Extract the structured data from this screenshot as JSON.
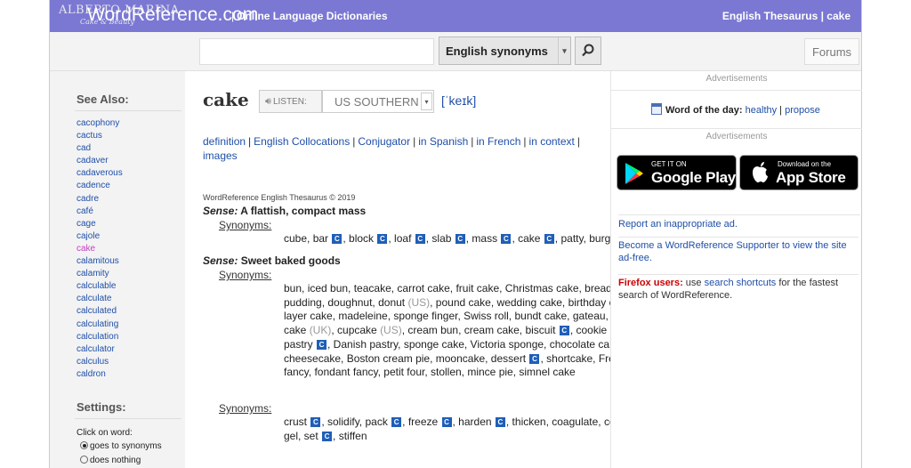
{
  "header": {
    "logo": "WordReference.com",
    "tagline": "Online Language Dictionaries",
    "watermark_top": "ALBERTO MARINA",
    "watermark_bottom": "Cake & Beauty",
    "thesaurus_link": "English Thesaurus",
    "thesaurus_word": "cake"
  },
  "search": {
    "query": "",
    "dictionary": "English synonyms",
    "forums_label": "Forums"
  },
  "sidebar": {
    "see_also_heading": "See Also:",
    "see_also": [
      "cacophony",
      "cactus",
      "cad",
      "cadaver",
      "cadaverous",
      "cadence",
      "cadre",
      "café",
      "cage",
      "cajole",
      "cake",
      "calamitous",
      "calamity",
      "calculable",
      "calculate",
      "calculated",
      "calculating",
      "calculation",
      "calculator",
      "calculus",
      "caldron"
    ],
    "current_word": "cake",
    "settings_heading": "Settings:",
    "click_on_word": "Click on word:",
    "option_synonyms": "goes to synonyms",
    "option_nothing": "does nothing"
  },
  "entry": {
    "headword": "cake",
    "listen_label": "LISTEN:",
    "accent": "US SOUTHERN",
    "ipa": "[ˈkeɪk]",
    "related_links": [
      "definition",
      "English Collocations",
      "Conjugator",
      "in Spanish",
      "in French",
      "in context",
      "images"
    ],
    "credit": "WordReference English Thesaurus © 2019",
    "sense_label": "Sense:",
    "synonyms_label": "Synonyms:",
    "sense1": "A flattish, compact mass",
    "sense2": "Sweet baked goods"
  },
  "right": {
    "ads_label": "Advertisements",
    "wotd_label": "Word of the day:",
    "wotd_word": "healthy",
    "wotd_propose": "propose",
    "google_small": "GET IT ON",
    "google_big": "Google Play",
    "apple_small": "Download on the",
    "apple_big": "App Store",
    "report": "Report an inappropriate ad.",
    "become": "Become a WordReference Supporter to view the site ad-free.",
    "firefox_label": "Firefox users:",
    "firefox_pre": " use ",
    "firefox_link": "search shortcuts",
    "firefox_post": " for the fastest search of WordReference."
  },
  "colors": {
    "topbar": "#7b78d4",
    "link": "#1f4fa8",
    "current_word": "#c03fbf",
    "c_badge": "#1f5fb8"
  }
}
